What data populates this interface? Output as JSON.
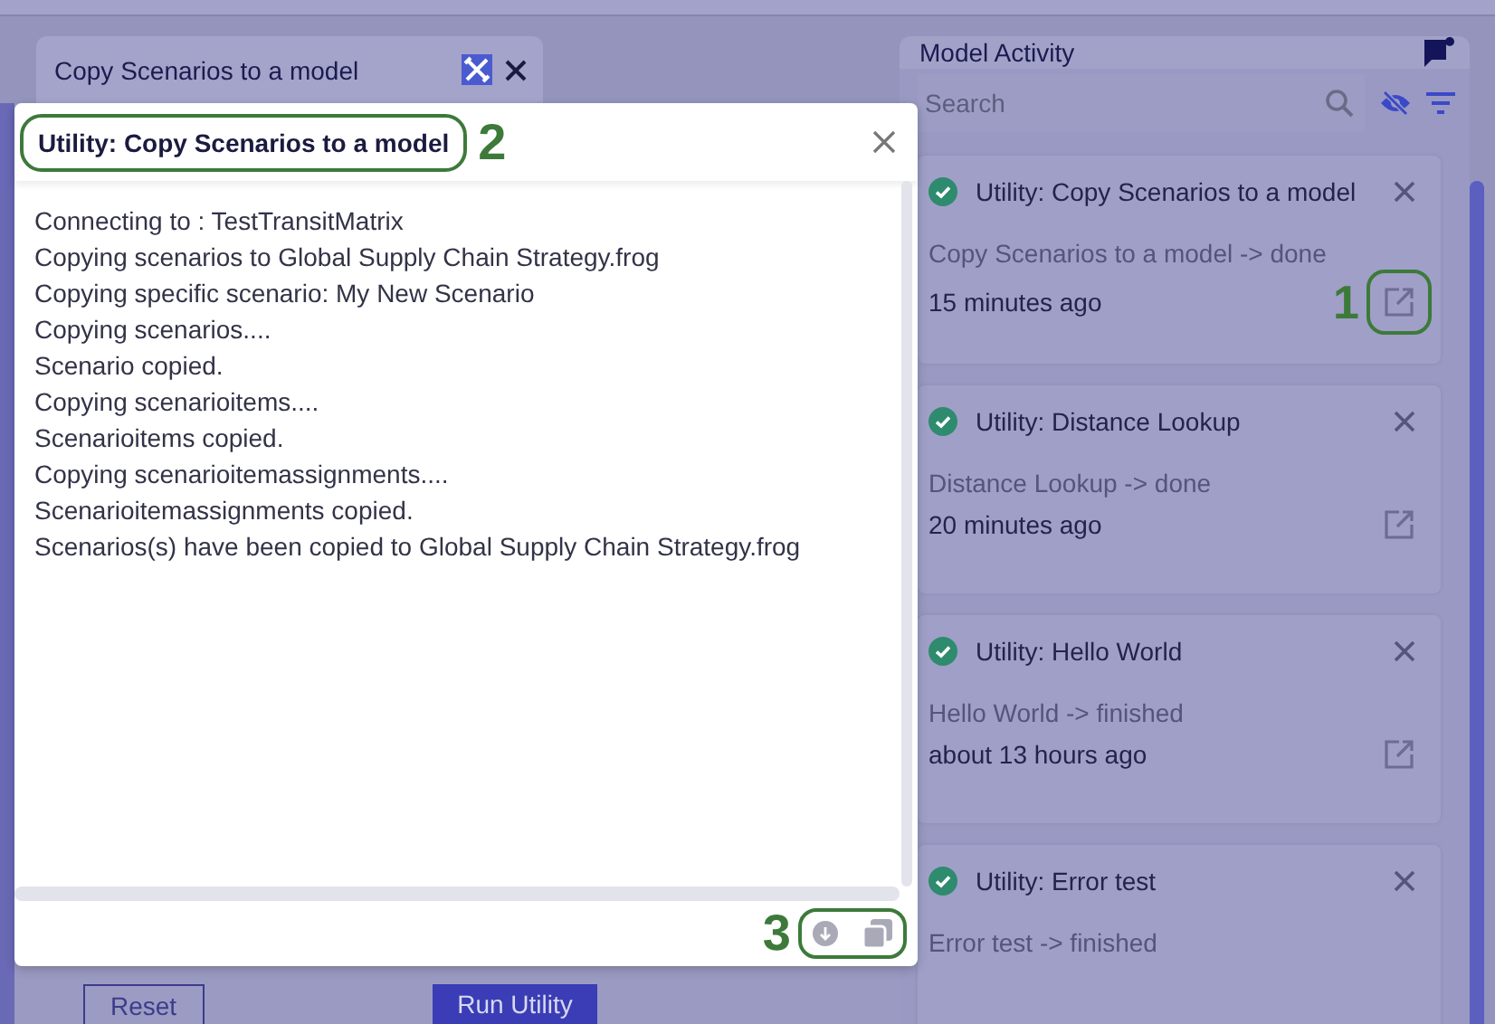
{
  "background_panel": {
    "tab_title": "Copy Scenarios to a model",
    "buttons": [
      {
        "label": "Reset",
        "kind": "outline"
      },
      {
        "label": "Run Utility",
        "kind": "primary"
      }
    ]
  },
  "dialog": {
    "title": "Utility: Copy Scenarios to a model",
    "title_callout": "2",
    "footer_callout": "3",
    "log": [
      "Connecting to : TestTransitMatrix",
      "Copying scenarios to Global Supply Chain Strategy.frog",
      "Copying specific scenario: My New Scenario",
      "Copying scenarios....",
      "Scenario copied.",
      "Copying scenarioitems....",
      "Scenarioitems copied.",
      "Copying scenarioitemassignments....",
      "Scenarioitemassignments copied.",
      "Scenarios(s) have been copied to Global Supply Chain Strategy.frog"
    ]
  },
  "activity_panel": {
    "title": "Model Activity",
    "search": {
      "placeholder": "Search"
    },
    "cards": [
      {
        "succeeded": true,
        "title": "Utility: Copy Scenarios to a model",
        "message": "Copy Scenarios to a model -> done",
        "time": "15 minutes ago",
        "callout": "1"
      },
      {
        "succeeded": true,
        "title": "Utility: Distance Lookup",
        "message": "Distance Lookup -> done",
        "time": "20 minutes ago"
      },
      {
        "succeeded": true,
        "title": "Utility: Hello World",
        "message": "Hello World -> finished",
        "time": "about 13 hours ago"
      },
      {
        "succeeded": true,
        "title": "Utility: Error test",
        "message": "Error test -> finished"
      }
    ]
  }
}
